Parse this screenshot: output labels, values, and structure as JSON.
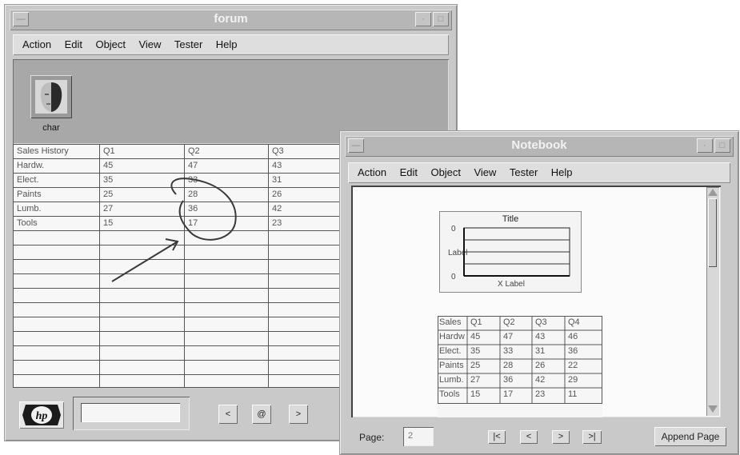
{
  "forum_window": {
    "title": "forum",
    "menu": [
      "Action",
      "Edit",
      "Object",
      "View",
      "Tester",
      "Help"
    ],
    "icon_label": "char",
    "table": {
      "headers": [
        "Sales History",
        "Q1",
        "Q2",
        "Q3"
      ],
      "rows": [
        [
          "Hardw.",
          "45",
          "47",
          "43"
        ],
        [
          "Elect.",
          "35",
          "33",
          "31"
        ],
        [
          "Paints",
          "25",
          "28",
          "26"
        ],
        [
          "Lumb.",
          "27",
          "36",
          "42"
        ],
        [
          "Tools",
          "15",
          "17",
          "23"
        ]
      ]
    },
    "logo": "hp",
    "nav_prev": "<",
    "nav_at": "@",
    "nav_next": ">"
  },
  "notebook_window": {
    "title": "Notebook",
    "menu": [
      "Action",
      "Edit",
      "Object",
      "View",
      "Tester",
      "Help"
    ],
    "chart": {
      "title": "Title",
      "y_top": "0",
      "y_bottom": "0",
      "y_label": "Label",
      "x_label": "X Label"
    },
    "table": {
      "headers": [
        "Sales",
        "Q1",
        "Q2",
        "Q3",
        "Q4"
      ],
      "rows": [
        [
          "Hardw",
          "45",
          "47",
          "43",
          "46"
        ],
        [
          "Elect.",
          "35",
          "33",
          "31",
          "36"
        ],
        [
          "Paints",
          "25",
          "28",
          "26",
          "22"
        ],
        [
          "Lumb.",
          "27",
          "36",
          "42",
          "29"
        ],
        [
          "Tools",
          "15",
          "17",
          "23",
          "11"
        ]
      ]
    },
    "page_label": "Page:",
    "page_value": "2",
    "nav_first": "|<",
    "nav_prev": "<",
    "nav_next": ">",
    "nav_last": ">|",
    "append_label": "Append Page"
  }
}
